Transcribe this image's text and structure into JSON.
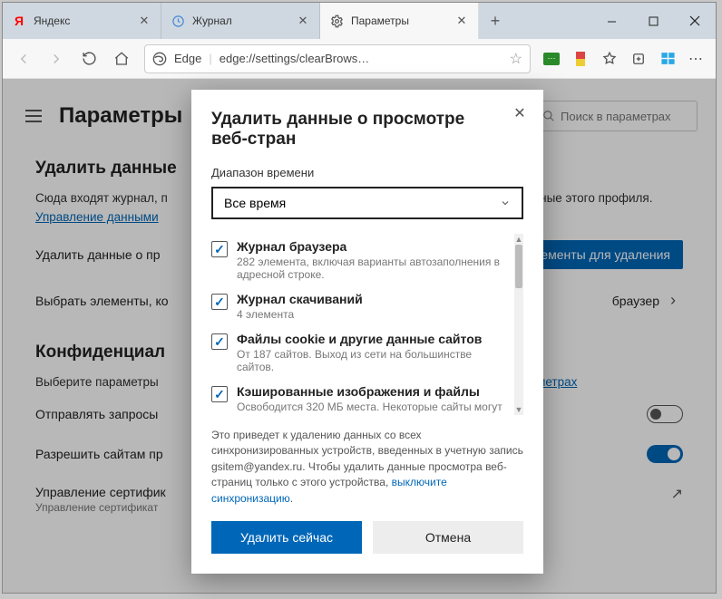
{
  "tabs": [
    {
      "label": "Яндекс",
      "icon": "Я",
      "icon_color": "#ff0000"
    },
    {
      "label": "Журнал",
      "icon": "history"
    },
    {
      "label": "Параметры",
      "icon": "gear"
    }
  ],
  "addressbar": {
    "engine_label": "Edge",
    "url": "edge://settings/clearBrows…"
  },
  "page": {
    "title": "Параметры",
    "search_placeholder": "Поиск в параметрах",
    "section1_title": "Удалить данные",
    "section1_desc_prefix": "Сюда входят журнал, п",
    "section1_desc_suffix": "данные этого профиля.",
    "section1_link": "Управление данными",
    "row_delete_label": "Удалить данные о пр",
    "row_delete_button": "элементы для удаления",
    "row_select_label": "Выбрать элементы, ко",
    "row_select_right": "браузер",
    "section2_title": "Конфиденциал",
    "section2_desc": "Выберите параметры",
    "section2_link": "параметрах",
    "row_send_label": "Отправлять запросы",
    "row_allow_label": "Разрешить сайтам пр",
    "row_cert_label": "Управление сертифик",
    "row_cert_sub": "Управление сертификат"
  },
  "dialog": {
    "title": "Удалить данные о просмотре веб-стран",
    "range_label": "Диапазон времени",
    "range_value": "Все время",
    "items": [
      {
        "checked": true,
        "title": "Журнал браузера",
        "sub": "282 элемента, включая варианты автозаполнения в адресной строке."
      },
      {
        "checked": true,
        "title": "Журнал скачиваний",
        "sub": "4 элемента"
      },
      {
        "checked": true,
        "title": "Файлы cookie и другие данные сайтов",
        "sub": "От 187 сайтов. Выход из сети на большинстве сайтов."
      },
      {
        "checked": true,
        "title": "Кэшированные изображения и файлы",
        "sub": "Освободится 320 МБ места. Некоторые сайты могут"
      }
    ],
    "note_prefix": "Это приведет к удалению данных со всех синхронизированных устройств, введенных в учетную запись gsitem@yandex.ru. Чтобы удалить данные просмотра веб-страниц только с этого устройства, ",
    "note_link": "выключите синхронизацию",
    "note_suffix": ".",
    "btn_primary": "Удалить сейчас",
    "btn_secondary": "Отмена"
  }
}
